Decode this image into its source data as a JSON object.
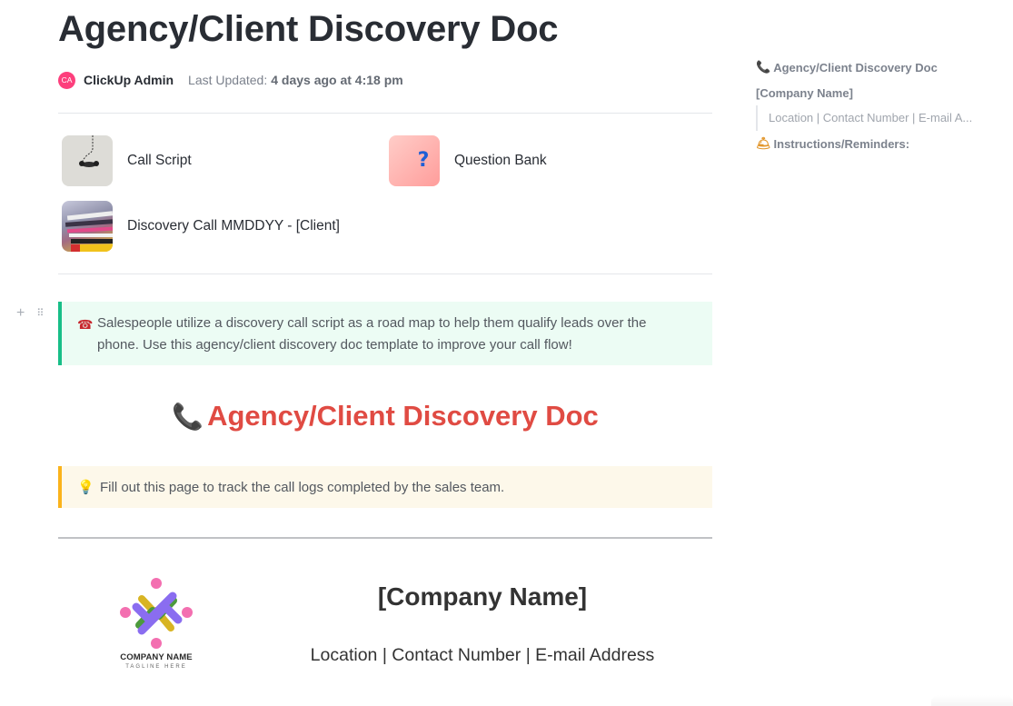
{
  "page": {
    "title": "Agency/Client Discovery Doc",
    "author": {
      "initials": "CA",
      "name": "ClickUp Admin",
      "avatar_color": "#fd3f7c"
    },
    "last_updated_label": "Last Updated:",
    "last_updated_value": "4 days ago at 4:18 pm"
  },
  "subpages": [
    {
      "label": "Call Script",
      "icon": "telephone-cord-thumbnail"
    },
    {
      "label": "Question Bank",
      "icon": "question-mark-thumbnail"
    },
    {
      "label": "Discovery Call MMDDYY - [Client]",
      "icon": "paper-stack-thumbnail"
    }
  ],
  "block_controls": {
    "add": "+",
    "drag": "⠿"
  },
  "callout_intro": {
    "emoji": "☎",
    "text": "Salespeople utilize a discovery call script as a road map to help them qualify leads over the phone. Use this agency/client discovery doc template to improve your call flow!",
    "accent": "#18be88",
    "background": "#ecfcf4"
  },
  "section_heading": {
    "emoji": "📞",
    "text": "Agency/Client Discovery Doc",
    "color": "#e04b43"
  },
  "callout_tip": {
    "emoji": "💡",
    "text": "Fill out this page to track the call logs completed by the sales team.",
    "accent": "#fbb31b",
    "background": "#fdf8ea"
  },
  "company_block": {
    "logo_name": "COMPANY NAME",
    "logo_tagline": "TAGLINE HERE",
    "name": "[Company Name]",
    "contact": "Location | Contact Number | E-mail Address"
  },
  "table_of_contents": [
    {
      "label": "Agency/Client Discovery Doc",
      "icon": "📞",
      "level": 1
    },
    {
      "label": "[Company Name]",
      "icon": "",
      "level": 1
    },
    {
      "label": "Location | Contact Number | E-mail A...",
      "icon": "",
      "level": 2
    },
    {
      "label": "Instructions/Reminders:",
      "icon": "🛎",
      "level": 1
    }
  ]
}
